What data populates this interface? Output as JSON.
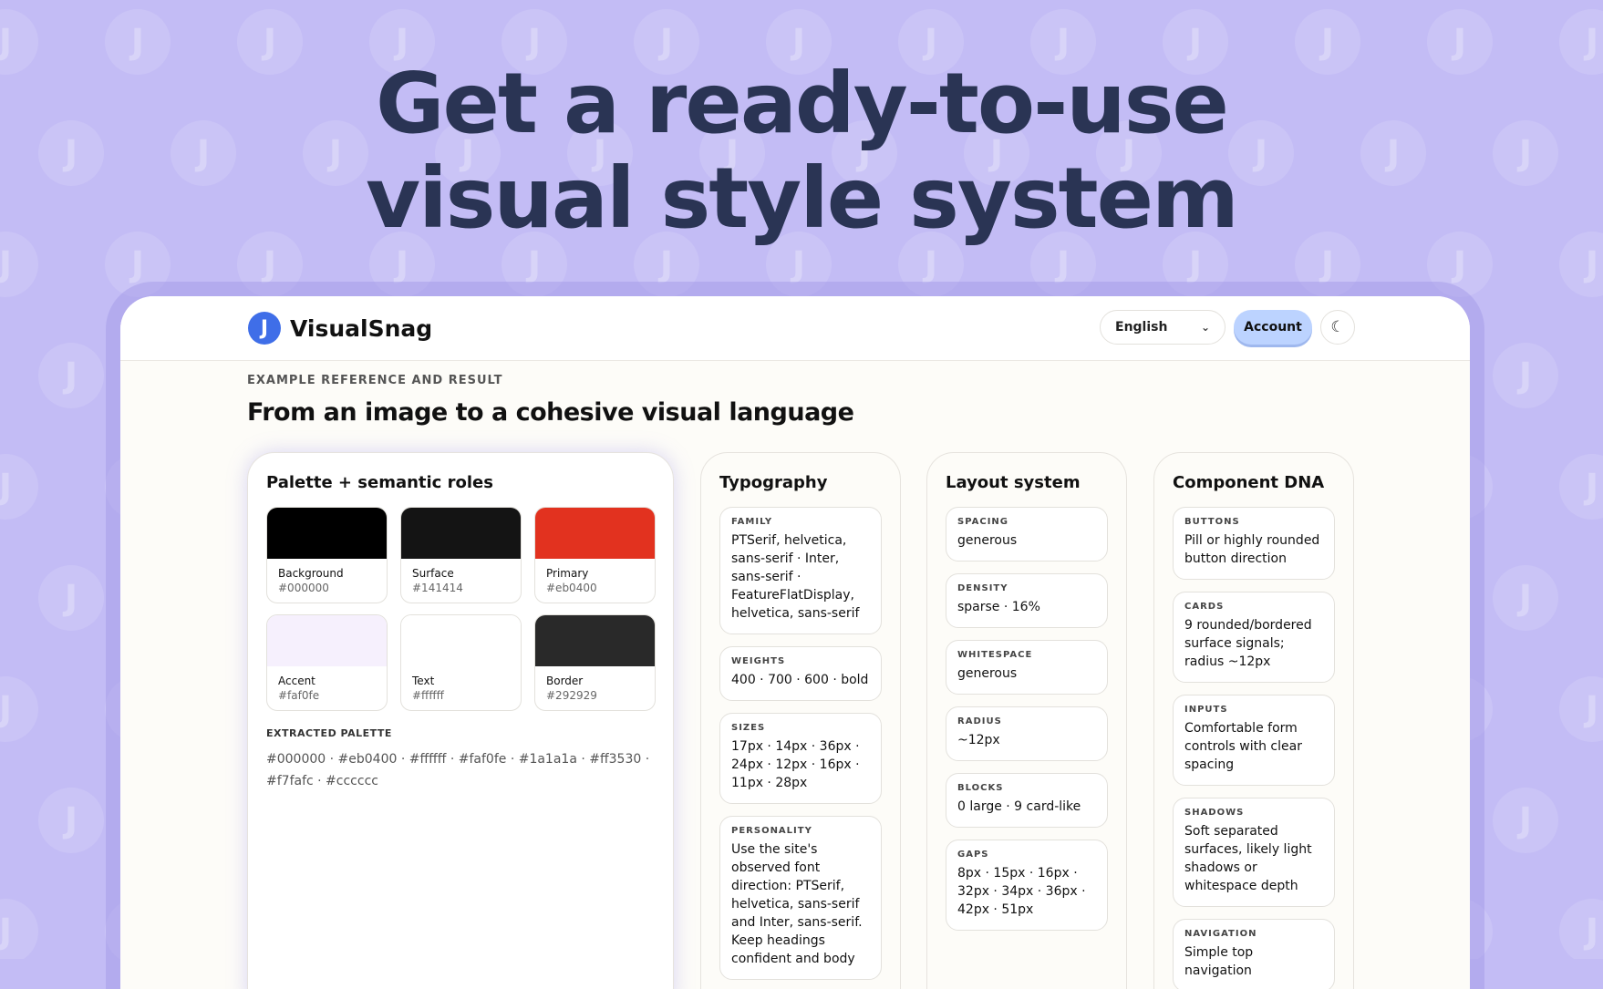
{
  "hero": {
    "line1": "Get a ready-to-use",
    "line2": "visual style system"
  },
  "topbar": {
    "brand": "VisualSnag",
    "logo_glyph": "J",
    "language": "English",
    "account_label": "Account",
    "theme_icon": "moon-icon"
  },
  "main": {
    "eyebrow": "EXAMPLE REFERENCE AND RESULT",
    "title": "From an image to a cohesive visual language"
  },
  "palette": {
    "title": "Palette + semantic roles",
    "swatches": [
      {
        "label": "Background",
        "hex": "#000000"
      },
      {
        "label": "Surface",
        "hex": "#141414"
      },
      {
        "label": "Primary",
        "hex": "#eb0400"
      },
      {
        "label": "Accent",
        "hex": "#faf0fe"
      },
      {
        "label": "Text",
        "hex": "#ffffff"
      },
      {
        "label": "Border",
        "hex": "#292929"
      }
    ],
    "extracted_title": "EXTRACTED PALETTE",
    "extracted": "#000000 · #eb0400 · #ffffff · #faf0fe · #1a1a1a · #ff3530 · #f7fafc · #cccccc"
  },
  "typography": {
    "title": "Typography",
    "items": [
      {
        "label": "FAMILY",
        "value": "PTSerif, helvetica, sans-serif · Inter, sans-serif · FeatureFlatDisplay, helvetica, sans-serif"
      },
      {
        "label": "WEIGHTS",
        "value": "400 · 700 · 600 · bold"
      },
      {
        "label": "SIZES",
        "value": "17px · 14px · 36px · 24px · 12px · 16px · 11px · 28px"
      },
      {
        "label": "PERSONALITY",
        "value": "Use the site's observed font direction: PTSerif, helvetica, sans-serif and Inter, sans-serif. Keep headings confident and body"
      }
    ]
  },
  "layout": {
    "title": "Layout system",
    "items": [
      {
        "label": "SPACING",
        "value": "generous"
      },
      {
        "label": "DENSITY",
        "value": "sparse · 16%"
      },
      {
        "label": "WHITESPACE",
        "value": "generous"
      },
      {
        "label": "RADIUS",
        "value": "~12px"
      },
      {
        "label": "BLOCKS",
        "value": "0 large · 9 card-like"
      },
      {
        "label": "GAPS",
        "value": "8px · 15px · 16px · 32px · 34px · 36px · 42px · 51px"
      }
    ]
  },
  "dna": {
    "title": "Component DNA",
    "items": [
      {
        "label": "BUTTONS",
        "value": "Pill or highly rounded button direction"
      },
      {
        "label": "CARDS",
        "value": "9 rounded/bordered surface signals; radius ~12px"
      },
      {
        "label": "INPUTS",
        "value": "Comfortable form controls with clear spacing"
      },
      {
        "label": "SHADOWS",
        "value": "Soft separated surfaces, likely light shadows or whitespace depth"
      },
      {
        "label": "NAVIGATION",
        "value": "Simple top navigation"
      }
    ]
  }
}
